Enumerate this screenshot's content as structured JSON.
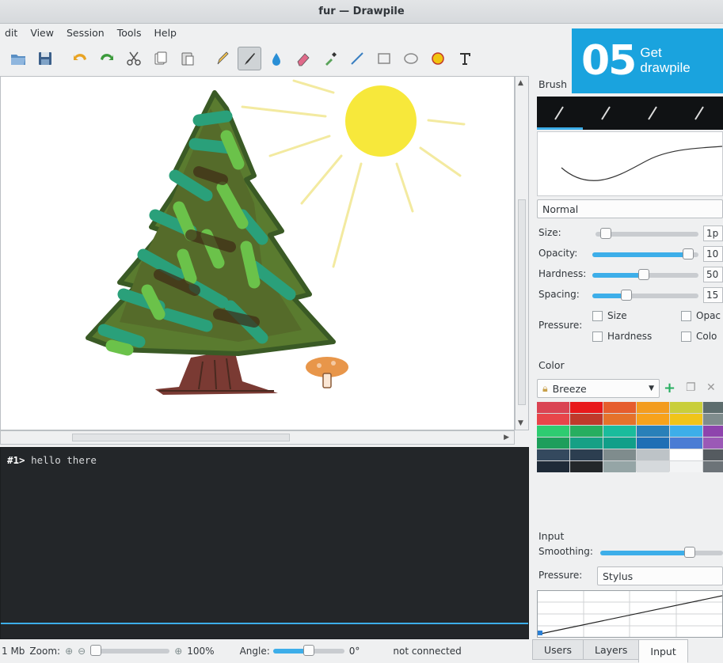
{
  "window": {
    "title": "fur — Drawpile"
  },
  "menu": {
    "items": [
      "dit",
      "View",
      "Session",
      "Tools",
      "Help"
    ]
  },
  "badge": {
    "number": "05",
    "line1": "Get",
    "line2": "drawpile"
  },
  "chat": {
    "prefix": "#1>",
    "message": "hello there"
  },
  "status": {
    "memory": "1 Mb",
    "zoom_label": "Zoom:",
    "zoom_value": "100%",
    "angle_label": "Angle:",
    "angle_value": "0°",
    "connection": "not connected"
  },
  "brush_dock": {
    "title": "Brush",
    "blend_mode": "Normal",
    "size_label": "Size:",
    "size_value": "1p",
    "opacity_label": "Opacity:",
    "opacity_value": "10",
    "hardness_label": "Hardness:",
    "hardness_value": "50",
    "spacing_label": "Spacing:",
    "spacing_value": "15",
    "pressure_label": "Pressure:",
    "pressure_size": "Size",
    "pressure_opacity": "Opac",
    "pressure_hardness": "Hardness",
    "pressure_color": "Colo",
    "levels": {
      "size": 0.05,
      "opacity": 0.95,
      "hardness": 0.48,
      "spacing": 0.3
    }
  },
  "color_dock": {
    "title": "Color",
    "palette_name": "Breeze",
    "swatches": [
      "#da4453",
      "#e8191b",
      "#e65d2d",
      "#f39c1f",
      "#c9ce3b",
      "#5d6d6e",
      "#e8454a",
      "#c0392b",
      "#e5722b",
      "#f7a21b",
      "#f0c419",
      "#7f8c8d",
      "#2ecc71",
      "#27ae60",
      "#1abc9c",
      "#2980b9",
      "#3daee9",
      "#8e44ad",
      "#1d9e5b",
      "#16a085",
      "#119f89",
      "#1f6fb5",
      "#4a7cd4",
      "#9b59b6",
      "#34495e",
      "#2c3e50",
      "#7f8c8d",
      "#bdc3c7",
      "#ffffff",
      "#555b60",
      "#1e2a38",
      "#23272a",
      "#95a5a6",
      "#d5d9dc",
      "#f3f4f5",
      "#6c7378"
    ]
  },
  "input_dock": {
    "title": "Input",
    "smoothing_label": "Smoothing:",
    "smoothing_level": 0.75,
    "pressure_label": "Pressure:",
    "pressure_mode": "Stylus"
  },
  "dock_tabs": [
    "Users",
    "Layers",
    "Input"
  ],
  "colors": {
    "accent": "#3daee9",
    "chat_bg": "#232629",
    "badge": "#1aa3de"
  }
}
